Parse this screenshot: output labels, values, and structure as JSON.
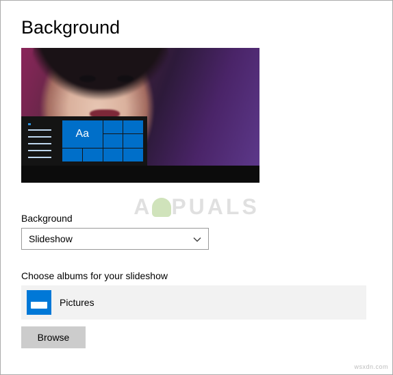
{
  "page": {
    "title": "Background"
  },
  "preview": {
    "tile_sample_text": "Aa"
  },
  "watermark": {
    "text_left": "A",
    "text_right": "PUALS"
  },
  "background_dropdown": {
    "label": "Background",
    "selected": "Slideshow"
  },
  "albums": {
    "label": "Choose albums for your slideshow",
    "items": [
      {
        "name": "Pictures",
        "icon": "pictures-folder-icon"
      }
    ]
  },
  "actions": {
    "browse_label": "Browse"
  },
  "footer": {
    "source": "wsxdn.com"
  }
}
